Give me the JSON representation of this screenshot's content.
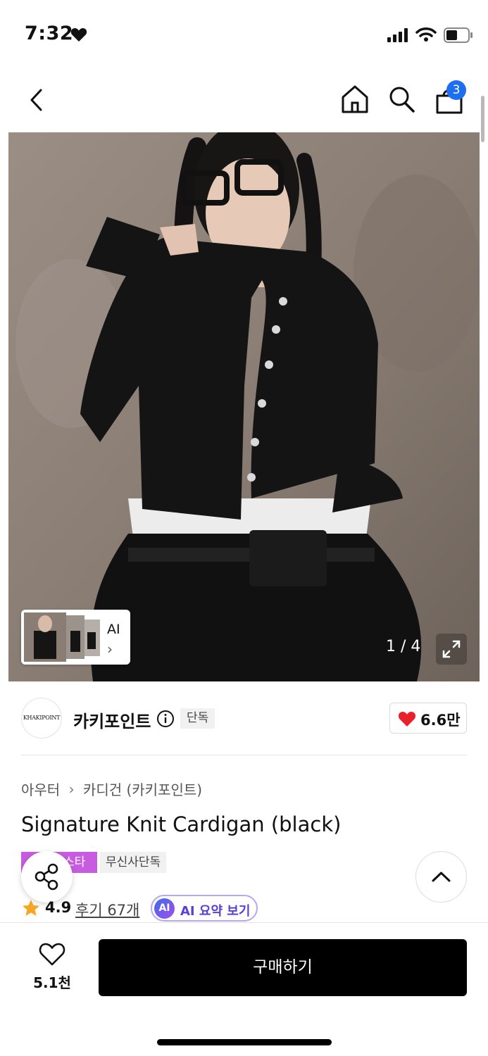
{
  "status_bar": {
    "time": "7:32",
    "icons": [
      "heart-icon",
      "signal-icon",
      "wifi-icon",
      "battery-icon"
    ]
  },
  "nav": {
    "icons": [
      "back-arrow-icon",
      "home-icon",
      "search-icon",
      "shopping-bag-icon"
    ],
    "cart_count": "3"
  },
  "gallery": {
    "thumb_label": "AI",
    "thumb_chevron": "›",
    "page_counter": "1 / 4"
  },
  "brand": {
    "logo_text": "KHAKIPOINT",
    "name": "카키포인트",
    "exclusive_tag": "단독",
    "like_count": "6.6만"
  },
  "product": {
    "breadcrumb": [
      "아우터",
      "카디건 (카키포인트)"
    ],
    "breadcrumb_separator": "›",
    "title": "Signature Knit Cardigan (black)",
    "tags": [
      "스타",
      "무신사단독"
    ],
    "rating": "4.9",
    "review_label": "후기 67개",
    "ai_badge": "AI",
    "ai_summary_label": "AI 요약 보기"
  },
  "bottom_bar": {
    "wish_count": "5.1천",
    "buy_label": "구매하기"
  },
  "colors": {
    "accent_blue": "#1e6ef0",
    "tag_purple": "#c85ce0",
    "heart_red": "#e8212b",
    "star_orange": "#f5a623",
    "buy_button": "#000000"
  }
}
